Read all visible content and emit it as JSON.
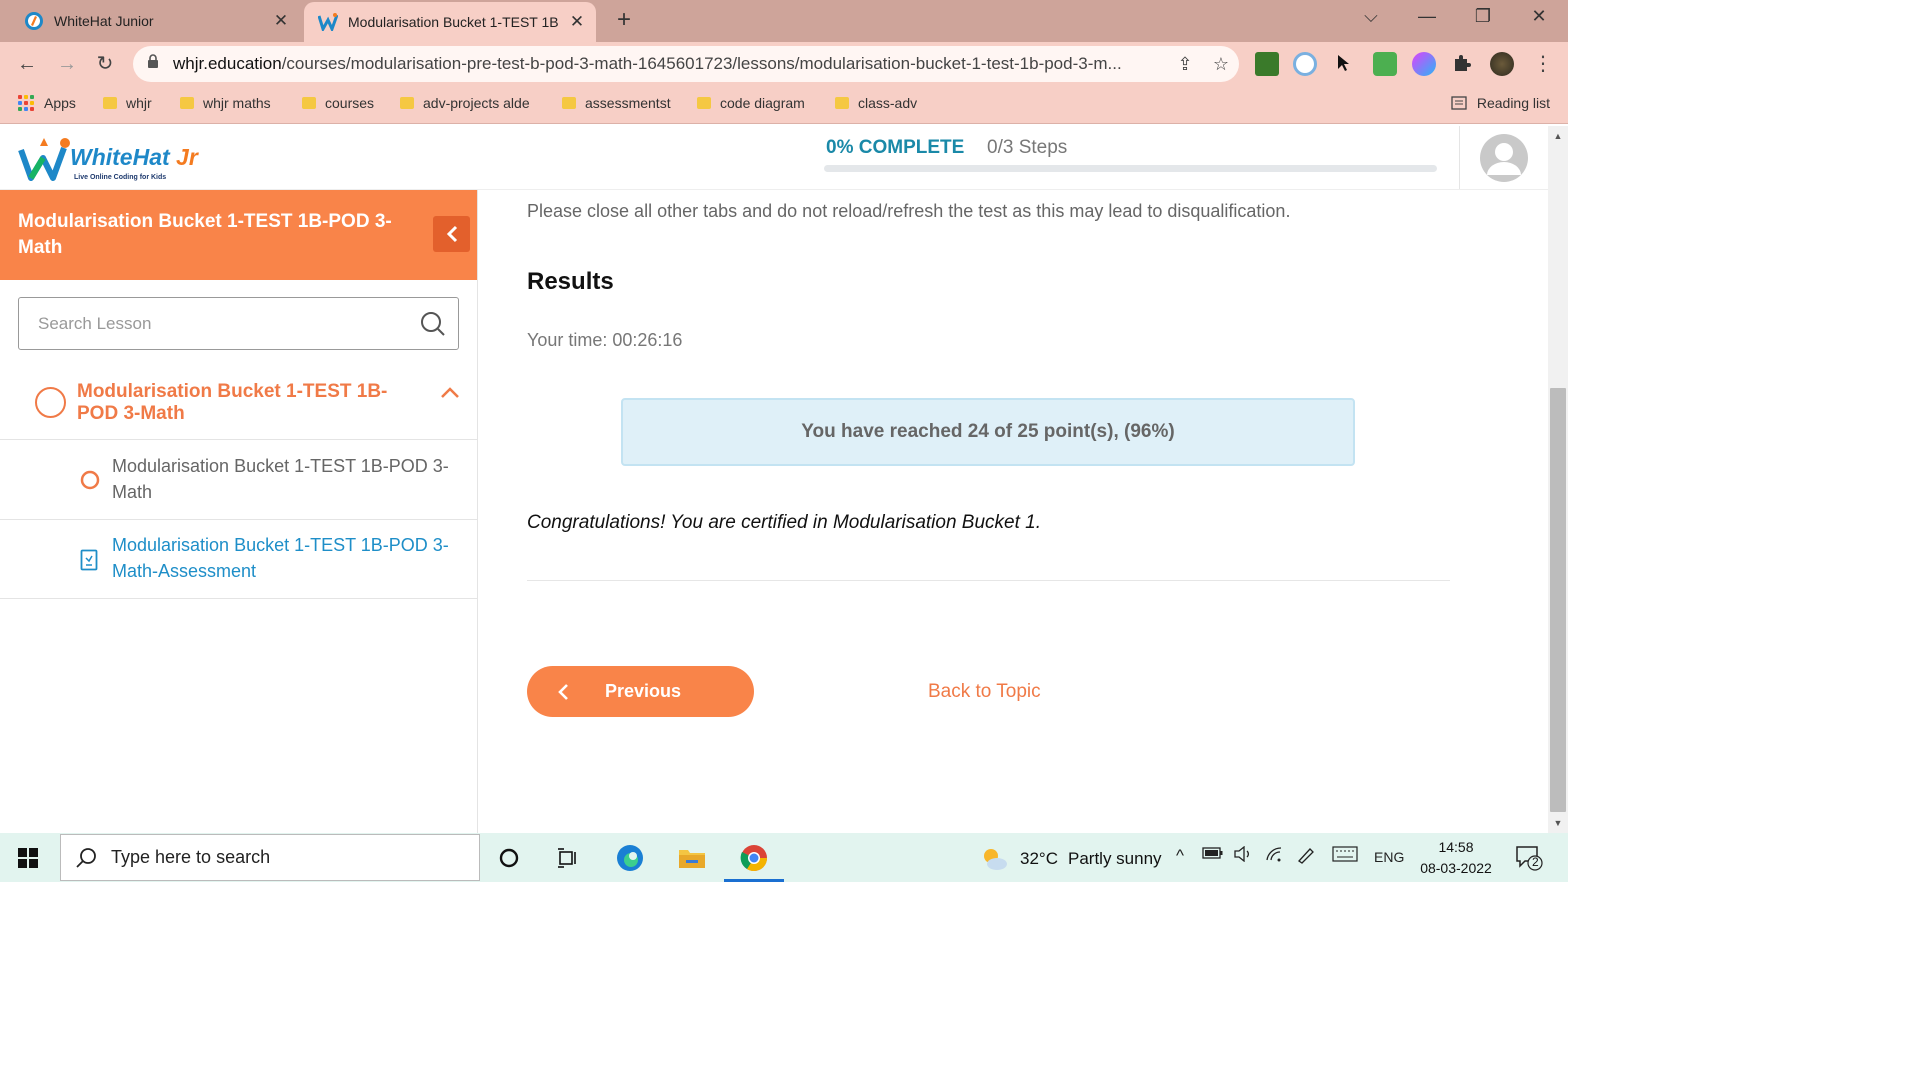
{
  "browser": {
    "tabs": [
      {
        "title": "WhiteHat Junior",
        "close": "✕"
      },
      {
        "title": "Modularisation Bucket 1-TEST 1B",
        "close": "✕"
      }
    ],
    "new_tab": "+",
    "window_controls": {
      "dropdown": "⌵",
      "minimize": "—",
      "restore": "❐",
      "close": "✕"
    },
    "url_host": "whjr.education",
    "url_path": "/courses/modularisation-pre-test-b-pod-3-math-1645601723/lessons/modularisation-bucket-1-test-1b-pod-3-m...",
    "nav": {
      "back": "←",
      "forward": "→",
      "reload": "↻"
    },
    "omnibox_icons": {
      "share": "⇪",
      "star": "☆"
    },
    "bookmarks": [
      "Apps",
      "whjr",
      "whjr maths",
      "courses",
      "adv-projects alde",
      "assessmentst",
      "code diagram",
      "class-adv"
    ],
    "reading_list": "Reading list",
    "menu": "⋮"
  },
  "header": {
    "logo_brand": "WhiteHat",
    "logo_jr": " Jr",
    "logo_tagline": "Live Online Coding for Kids",
    "progress_label": "0% COMPLETE",
    "progress_steps": "0/3 Steps",
    "progress_fraction": 0.0
  },
  "sidebar": {
    "course_title": "Modularisation Bucket 1-TEST 1B-POD 3-Math",
    "search_placeholder": "Search Lesson",
    "topic_title": "Modularisation Bucket 1-TEST 1B-POD 3-Math",
    "lessons": [
      {
        "title": "Modularisation Bucket 1-TEST 1B-POD 3-Math"
      },
      {
        "title": "Modularisation Bucket 1-TEST 1B-POD 3-Math-Assessment"
      }
    ]
  },
  "main": {
    "notice": "Please close all other tabs and do not reload/refresh the test as this may lead to disqualification.",
    "results_heading": "Results",
    "your_time": "Your time: 00:26:16",
    "score_message": "You have reached 24 of 25 point(s), (96%)",
    "congrats": "Congratulations! You are certified in Modularisation Bucket 1.",
    "previous_label": "Previous",
    "back_to_topic": "Back to Topic"
  },
  "taskbar": {
    "search_placeholder": "Type here to search",
    "weather_temp": "32°C",
    "weather_desc": "Partly sunny",
    "tray_caret": "^",
    "language": "ENG",
    "time": "14:58",
    "date": "08-03-2022",
    "notification_count": "2"
  },
  "colors": {
    "accent_orange": "#f98449",
    "progress_teal": "#1a89a8",
    "link_blue": "#1e8ec8",
    "chrome_tab": "#cea49a"
  }
}
